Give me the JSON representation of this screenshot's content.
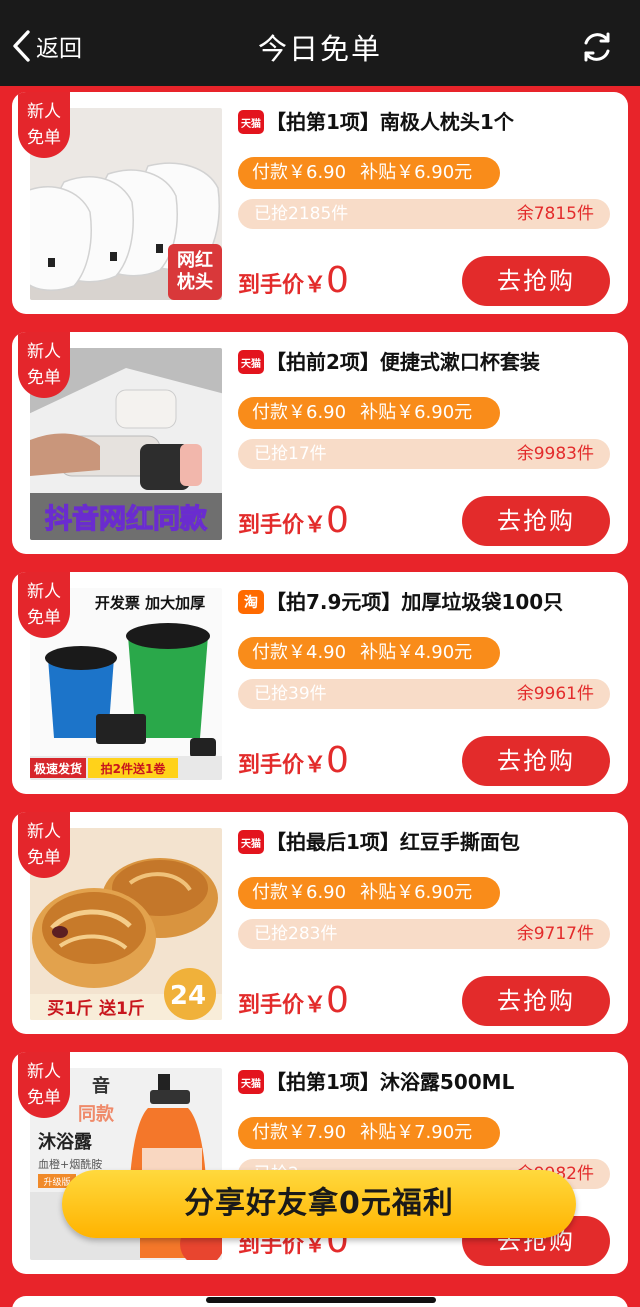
{
  "header": {
    "back_label": "返回",
    "title": "今日免单",
    "back_icon": "chevron-left-icon",
    "refresh_icon": "refresh-icon"
  },
  "badge_text": "新人\n免单",
  "products": [
    {
      "shop": "天猫",
      "shop_type": "tmall",
      "title": "【拍第1项】南极人枕头1个",
      "price_text": "付款￥6.90",
      "subsidy_text": "补贴￥6.90元",
      "sold_text": "已抢2185件",
      "remain_text": "余7815件",
      "net_label": "到手价￥",
      "net_value": "0",
      "buy_label": "去抢购",
      "image_text": "网红\n枕头"
    },
    {
      "shop": "天猫",
      "shop_type": "tmall",
      "title": "【拍前2项】便捷式漱口杯套装",
      "price_text": "付款￥6.90",
      "subsidy_text": "补贴￥6.90元",
      "sold_text": "已抢17件",
      "remain_text": "余9983件",
      "net_label": "到手价￥",
      "net_value": "0",
      "buy_label": "去抢购",
      "image_text": "抖音网红同款"
    },
    {
      "shop": "淘",
      "shop_type": "taobao",
      "title": "【拍7.9元项】加厚垃圾袋100只",
      "price_text": "付款￥4.90",
      "subsidy_text": "补贴￥4.90元",
      "sold_text": "已抢39件",
      "remain_text": "余9961件",
      "net_label": "到手价￥",
      "net_value": "0",
      "buy_label": "去抢购",
      "image_text": "开发票 加大加厚",
      "image_text_2": "极速发货",
      "image_text_3": "拍2件送1卷"
    },
    {
      "shop": "天猫",
      "shop_type": "tmall",
      "title": "【拍最后1项】红豆手撕面包",
      "price_text": "付款￥6.90",
      "subsidy_text": "补贴￥6.90元",
      "sold_text": "已抢283件",
      "remain_text": "余9717件",
      "net_label": "到手价￥",
      "net_value": "0",
      "buy_label": "去抢购",
      "image_text": "买1斤 送1斤",
      "image_text_2": "24"
    },
    {
      "shop": "天猫",
      "shop_type": "tmall",
      "title": "【拍第1项】沐浴露500ML",
      "price_text": "付款￥7.90",
      "subsidy_text": "补贴￥7.90元",
      "sold_text": "已抢2",
      "remain_text": "余9982件",
      "net_label": "到手价￥",
      "net_value": "0",
      "buy_label": "去抢购",
      "image_text": "音",
      "image_text_2": "同款",
      "image_text_3": "沐浴露",
      "image_text_4": "血橙+烟酰胺",
      "image_text_5": "升级版"
    }
  ],
  "share_button": "分享好友拿0元福利",
  "colors": {
    "background": "#e8242a",
    "header": "#1a1a1a",
    "accent_red": "#e32b2b",
    "orange": "#f98c1a",
    "stock_bar": "#f8dcc8",
    "share_yellow": "#ffc21a"
  }
}
